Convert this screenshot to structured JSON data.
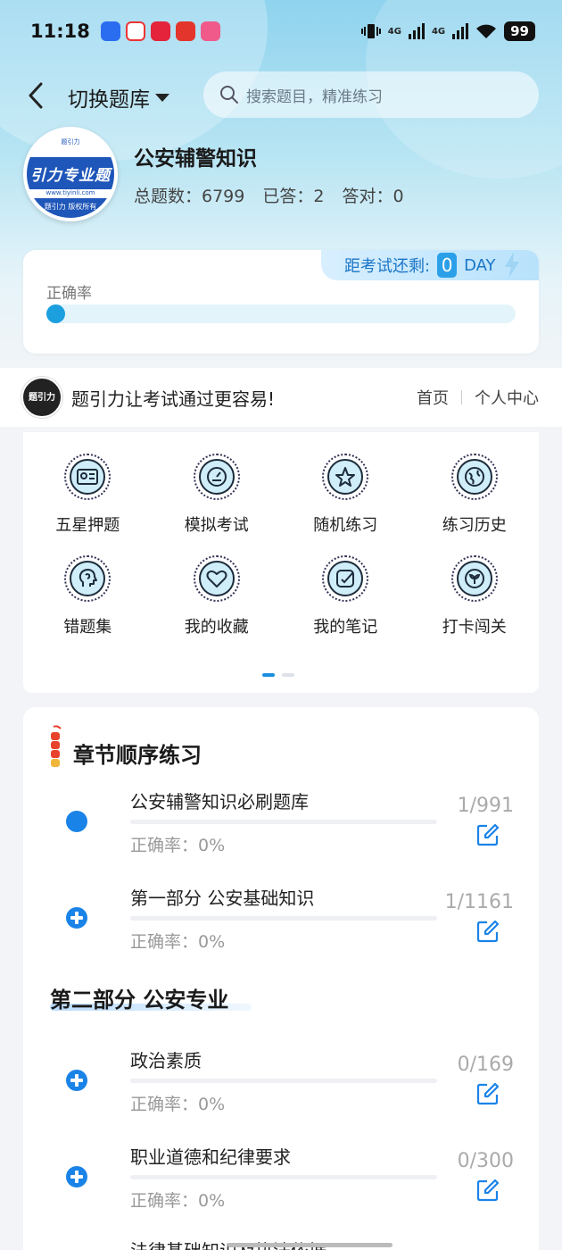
{
  "status_bar": {
    "time": "11:18",
    "network_1": "4G",
    "network_2": "4G",
    "battery": "99"
  },
  "header": {
    "switch_label": "切换题库",
    "search_placeholder": "搜索题目，精准练习"
  },
  "bank": {
    "title": "公安辅警知识",
    "total": "总题数：6799",
    "answered": "已答：2",
    "correct": "答对：0",
    "logo_text": "引力专业题",
    "logo_url": "www.tiyinli.com",
    "logo_footer": "题引力 版权所有",
    "logo_header": "题引力"
  },
  "accuracy": {
    "label": "正确率",
    "countdown_label": "距考试还剩:",
    "countdown_days": "0",
    "countdown_unit": "DAY",
    "accuracy_value": 0
  },
  "brand": {
    "logo_text": "题引力",
    "slogan": "题引力让考试通过更容易!",
    "home": "首页",
    "profile": "个人中心"
  },
  "grid": [
    {
      "label": "五星押题",
      "icon": "id-card-icon"
    },
    {
      "label": "模拟考试",
      "icon": "speedometer-icon"
    },
    {
      "label": "随机练习",
      "icon": "random-star-icon"
    },
    {
      "label": "练习历史",
      "icon": "globe-history-icon"
    },
    {
      "label": "错题集",
      "icon": "head-brain-icon"
    },
    {
      "label": "我的收藏",
      "icon": "heart-icon"
    },
    {
      "label": "我的笔记",
      "icon": "note-check-icon"
    },
    {
      "label": "打卡闯关",
      "icon": "sprout-icon"
    }
  ],
  "chapters": {
    "title": "章节顺序练习",
    "items": [
      {
        "name": "公安辅警知识必刷题库",
        "rate": "正确率：0%",
        "count": "1/991",
        "marker": "dot"
      },
      {
        "name": "第一部分 公安基础知识",
        "rate": "正确率：0%",
        "count": "1/1161",
        "marker": "plus"
      }
    ],
    "section_title": "第二部分 公安专业",
    "section_items": [
      {
        "name": "政治素质",
        "rate": "正确率：0%",
        "count": "0/169",
        "marker": "plus"
      },
      {
        "name": "职业道德和纪律要求",
        "rate": "正确率：0%",
        "count": "0/300",
        "marker": "plus"
      }
    ],
    "cut_item": "法律基础知识及执法依据"
  },
  "colors": {
    "accent": "#1a83e8",
    "hero_top": "#8fd3ee",
    "progress_track": "#e4f4fb"
  }
}
